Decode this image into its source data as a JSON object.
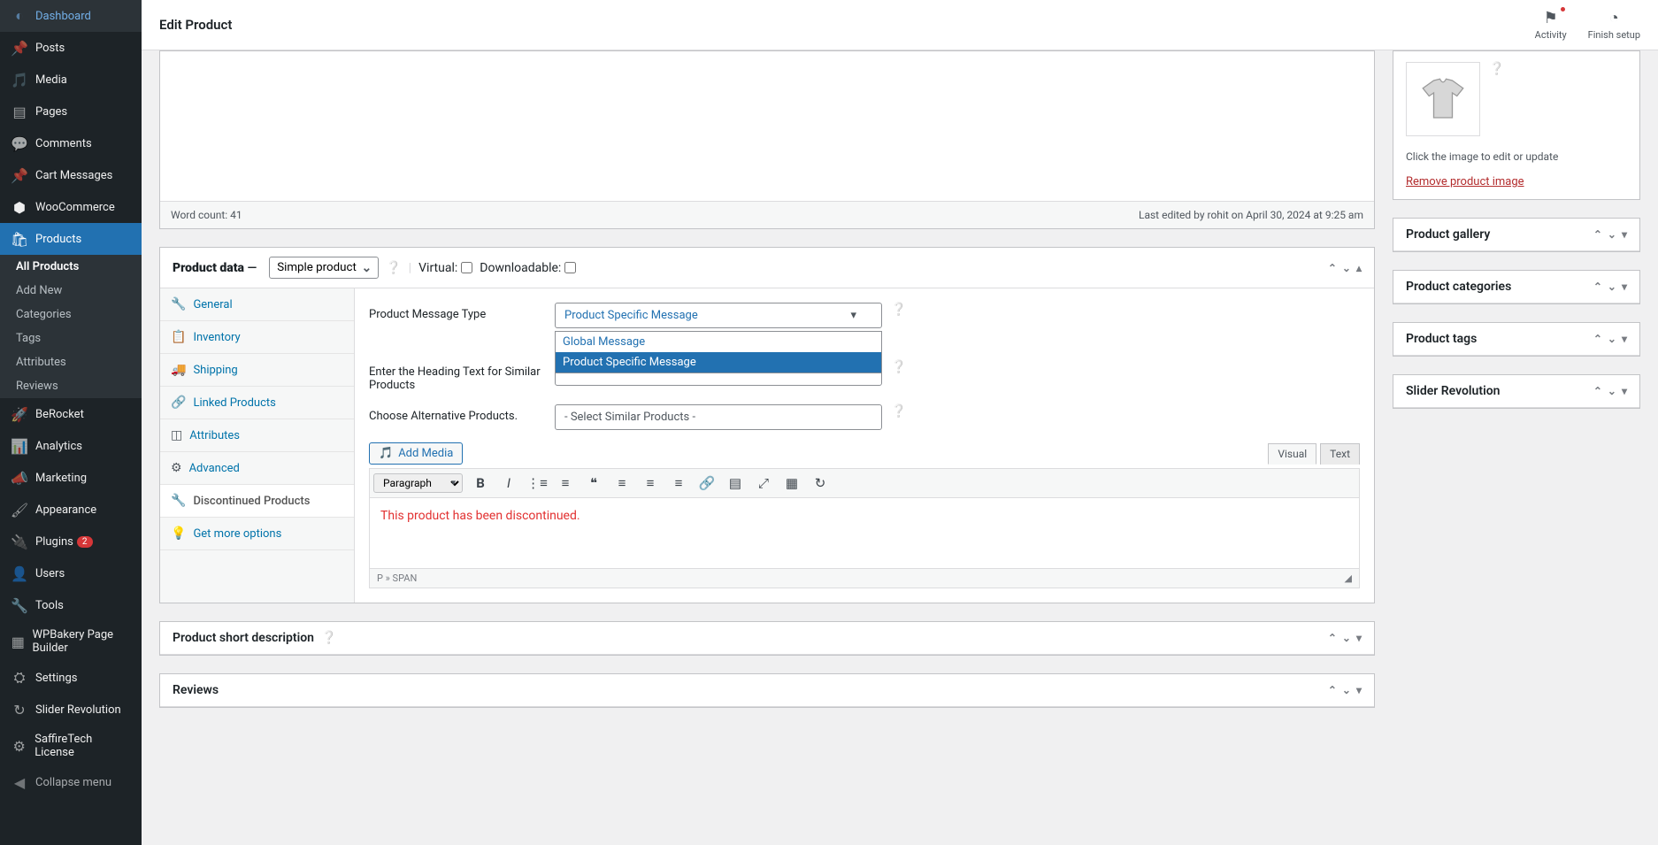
{
  "topbar": {
    "title": "Edit Product",
    "activity": "Activity",
    "finish_setup": "Finish setup"
  },
  "sidebar": {
    "dashboard": "Dashboard",
    "posts": "Posts",
    "media": "Media",
    "pages": "Pages",
    "comments": "Comments",
    "cart_messages": "Cart Messages",
    "woocommerce": "WooCommerce",
    "products": "Products",
    "products_sub": {
      "all": "All Products",
      "add": "Add New",
      "categories": "Categories",
      "tags": "Tags",
      "attributes": "Attributes",
      "reviews": "Reviews"
    },
    "berocket": "BeRocket",
    "analytics": "Analytics",
    "marketing": "Marketing",
    "appearance": "Appearance",
    "plugins": "Plugins",
    "plugins_badge": "2",
    "users": "Users",
    "tools": "Tools",
    "wpbakery": "WPBakery Page Builder",
    "settings": "Settings",
    "slider_rev": "Slider Revolution",
    "saffire": "SaffireTech License",
    "collapse": "Collapse menu"
  },
  "editor_status": {
    "word_count": "Word count: 41",
    "last_edited": "Last edited by rohit on April 30, 2024 at 9:25 am"
  },
  "product_data": {
    "title": "Product data",
    "type_select": "Simple product",
    "virtual": "Virtual:",
    "downloadable": "Downloadable:",
    "tabs": {
      "general": "General",
      "inventory": "Inventory",
      "shipping": "Shipping",
      "linked": "Linked Products",
      "attributes": "Attributes",
      "advanced": "Advanced",
      "discontinued": "Discontinued Products",
      "get_more": "Get more options"
    },
    "form": {
      "msg_type_label": "Product Message Type",
      "msg_type_value": "Product Specific Message",
      "msg_type_options": [
        "Global Message",
        "Product Specific Message"
      ],
      "heading_label": "Enter the Heading Text for Similar Products",
      "alt_label": "Choose Alternative Products.",
      "alt_placeholder": "- Select Similar Products -",
      "add_media": "Add Media",
      "switch_visual": "Visual",
      "switch_text": "Text",
      "block_format": "Paragraph",
      "editor_content": "This product has been discontinued.",
      "path": "P » SPAN"
    }
  },
  "short_desc": {
    "title": "Product short description"
  },
  "reviews": {
    "title": "Reviews"
  },
  "side": {
    "image_hint": "Click the image to edit or update",
    "remove_image": "Remove product image",
    "gallery": "Product gallery",
    "categories": "Product categories",
    "tags": "Product tags",
    "slider": "Slider Revolution"
  }
}
